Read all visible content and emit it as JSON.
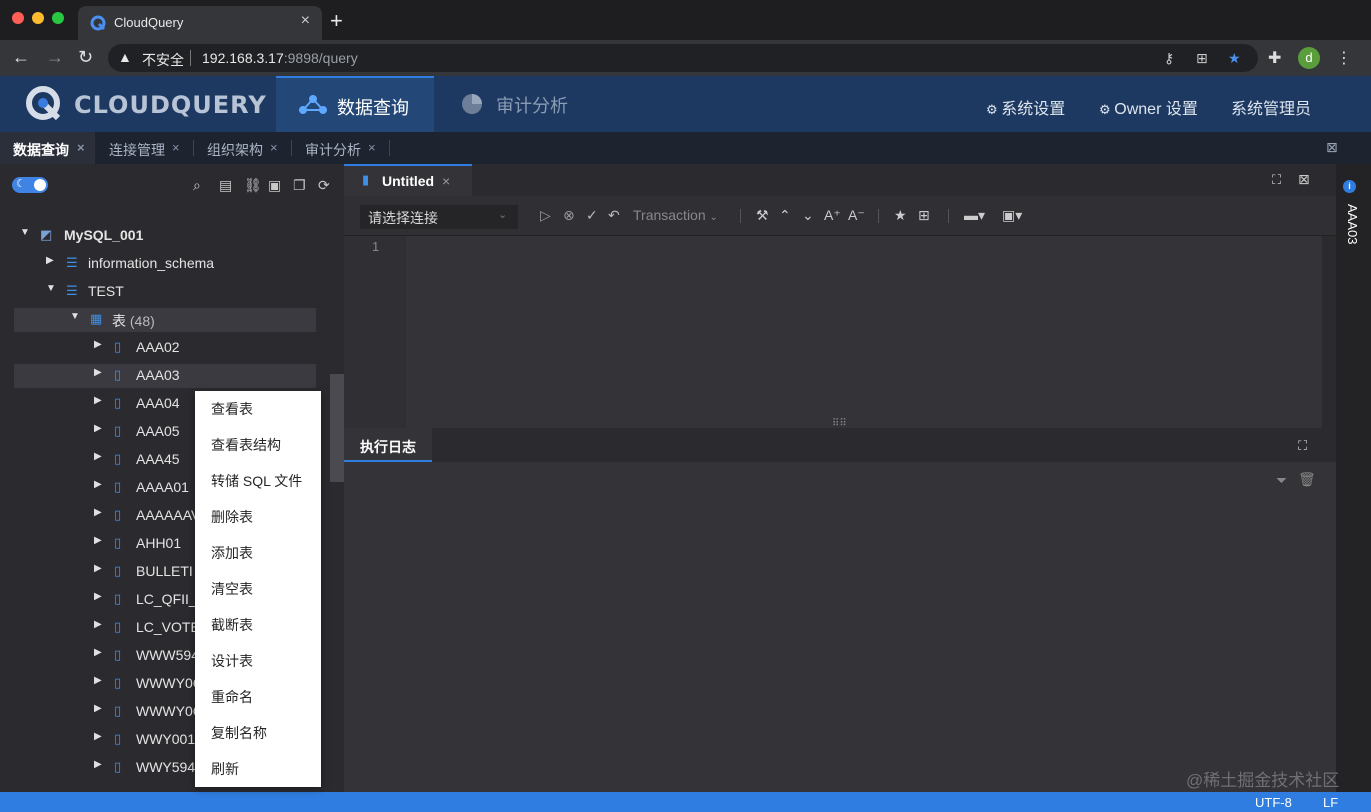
{
  "browser": {
    "tab_title": "CloudQuery",
    "tab_close": "×",
    "new_tab": "+",
    "insecure_label": "不安全",
    "url_host": "192.168.3.17",
    "url_path": ":9898/query",
    "profile_initial": "d"
  },
  "header": {
    "logo_text": "CLOUDQUERY",
    "nav_query": "数据查询",
    "nav_audit": "审计分析",
    "system_settings": "系统设置",
    "owner_settings": "Owner 设置",
    "admin": "系统管理员"
  },
  "app_tabs": [
    {
      "label": "数据查询",
      "close": "×"
    },
    {
      "label": "连接管理",
      "close": "×"
    },
    {
      "label": "组织架构",
      "close": "×"
    },
    {
      "label": "审计分析",
      "close": "×"
    }
  ],
  "tree": {
    "connection": "MySQL_001",
    "db1": "information_schema",
    "db2": "TEST",
    "tables_group": "表",
    "tables_count": "(48)",
    "tables": [
      "AAA02",
      "AAA03",
      "AAA04",
      "AAA05",
      "AAA45",
      "AAAA01",
      "AAAAAAV",
      "AHH01",
      "BULLETI",
      "LC_QFII_",
      "LC_VOTE",
      "WWW594",
      "WWWY0C",
      "WWWY0C",
      "WWY001",
      "WWY594"
    ]
  },
  "context_menu": [
    "查看表",
    "查看表结构",
    "转储 SQL 文件",
    "删除表",
    "添加表",
    "清空表",
    "截断表",
    "设计表",
    "重命名",
    "复制名称",
    "刷新"
  ],
  "editor": {
    "tab_title": "Untitled",
    "tab_close": "×",
    "connection_placeholder": "请选择连接",
    "transaction_label": "Transaction",
    "line_number": "1"
  },
  "log": {
    "tab_title": "执行日志"
  },
  "right_rail": {
    "info_icon": "i",
    "label": "AAA03"
  },
  "status": {
    "encoding": "UTF-8",
    "line_ending": "LF"
  },
  "watermark": "@稀土掘金技术社区",
  "colors": {
    "accent": "#2f7de1",
    "header_bg": "#1d3961",
    "sidebar_bg": "#2b2b2f"
  }
}
